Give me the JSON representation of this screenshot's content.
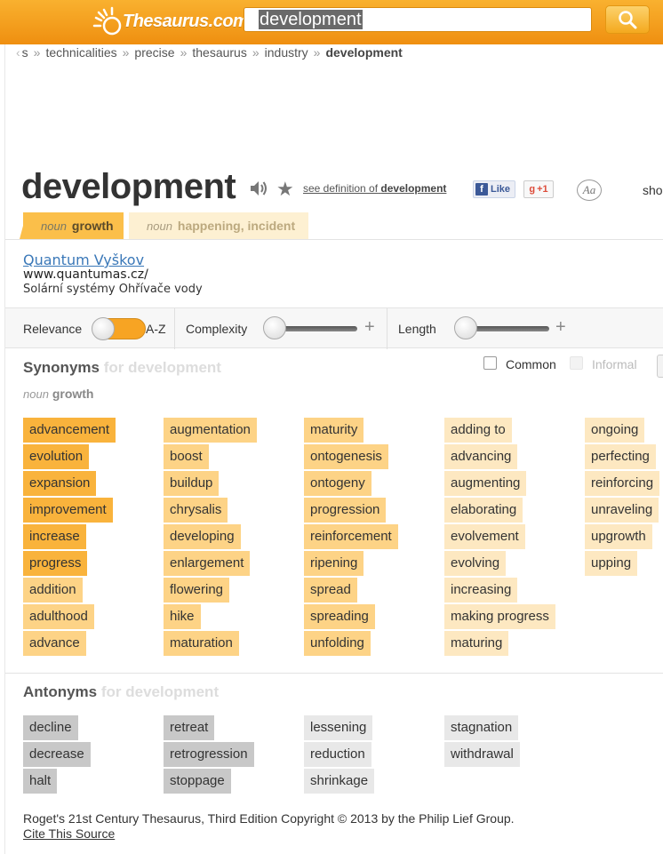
{
  "header": {
    "logo_text": "Thesaurus.com",
    "search_value": "development",
    "search_button_icon": "search-icon"
  },
  "breadcrumb": {
    "items": [
      "s",
      "technicalities",
      "precise",
      "thesaurus",
      "industry"
    ],
    "separator": "»",
    "current": "development"
  },
  "entry": {
    "word": "development",
    "see_definition_prefix": "see definition of",
    "see_definition_word": "development",
    "fb_like": "Like",
    "gplus": "+1",
    "font_toggle": "Aa",
    "show_clipped": "sho"
  },
  "senses": [
    {
      "pos": "noun",
      "label": "growth"
    },
    {
      "pos": "noun",
      "label": "happening, incident"
    }
  ],
  "ad": {
    "title": "Quantum Vyškov",
    "url": "www.quantumas.cz/",
    "description": "Solární systémy Ohřívače vody"
  },
  "filters": {
    "relevance_label": "Relevance",
    "az_label": "A-Z",
    "complexity_label": "Complexity",
    "length_label": "Length",
    "plus_symbol": "+"
  },
  "synonyms": {
    "title": "Synonyms",
    "for_text": "for development",
    "sense_pos": "noun",
    "sense_label": "growth",
    "common_label": "Common",
    "informal_label": "Informal",
    "columns": [
      [
        "advancement",
        "evolution",
        "expansion",
        "improvement",
        "increase",
        "progress",
        "addition",
        "adulthood",
        "advance"
      ],
      [
        "augmentation",
        "boost",
        "buildup",
        "chrysalis",
        "developing",
        "enlargement",
        "flowering",
        "hike",
        "maturation"
      ],
      [
        "maturity",
        "ontogenesis",
        "ontogeny",
        "progression",
        "reinforcement",
        "ripening",
        "spread",
        "spreading",
        "unfolding"
      ],
      [
        "adding to",
        "advancing",
        "augmenting",
        "elaborating",
        "evolvement",
        "evolving",
        "increasing",
        "making progress",
        "maturing"
      ],
      [
        "ongoing",
        "perfecting",
        "reinforcing",
        "unraveling",
        "upgrowth",
        "upping"
      ]
    ]
  },
  "antonyms": {
    "title": "Antonyms",
    "for_text": "for development",
    "columns": [
      [
        "decline",
        "decrease",
        "halt"
      ],
      [
        "retreat",
        "retrogression",
        "stoppage"
      ],
      [
        "lessening",
        "reduction",
        "shrinkage"
      ],
      [
        "stagnation",
        "withdrawal"
      ]
    ]
  },
  "footer": {
    "copyright": "Roget's 21st Century Thesaurus, Third Edition Copyright © 2013 by the Philip Lief Group.",
    "cite": "Cite This Source"
  },
  "colors": {
    "header_orange": "#f5a01f",
    "relevance_high": "#f9b33c",
    "relevance_mid": "#fdd386",
    "relevance_low": "#fde8c1"
  }
}
